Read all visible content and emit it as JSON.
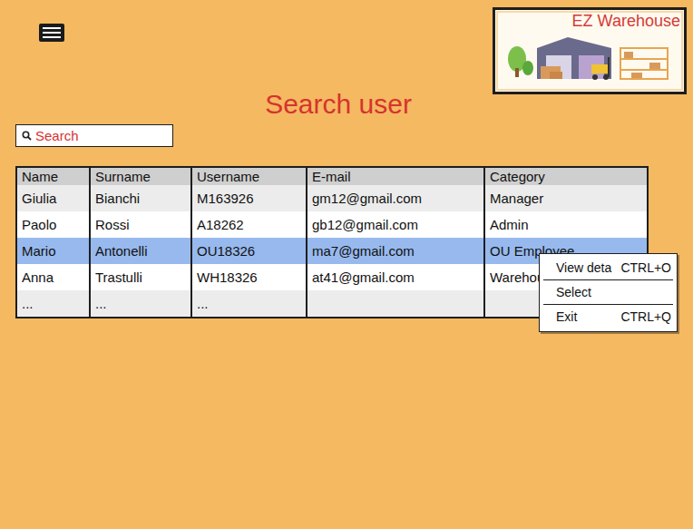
{
  "logo": {
    "text": "EZ Warehouse"
  },
  "title": "Search user",
  "search": {
    "placeholder": "Search"
  },
  "table": {
    "columns": [
      "Name",
      "Surname",
      "Username",
      "E-mail",
      "Category"
    ],
    "rows": [
      {
        "cells": [
          "Giulia",
          "Bianchi",
          "M163926",
          "gm12@gmail.com",
          "Manager"
        ],
        "selected": false
      },
      {
        "cells": [
          "Paolo",
          "Rossi",
          "A18262",
          "gb12@gmail.com",
          "Admin"
        ],
        "selected": false
      },
      {
        "cells": [
          "Mario",
          "Antonelli",
          "OU18326",
          "ma7@gmail.com",
          "OU Employee"
        ],
        "selected": true
      },
      {
        "cells": [
          "Anna",
          "Trastulli",
          "WH18326",
          "at41@gmail.com",
          "Warehouse Em"
        ],
        "selected": false
      },
      {
        "cells": [
          "...",
          "...",
          "...",
          "",
          ""
        ],
        "selected": false
      }
    ]
  },
  "context_menu": {
    "items": [
      {
        "label": "View deta",
        "shortcut": "CTRL+O"
      },
      {
        "label": "Select"
      },
      {
        "label": "Exit",
        "shortcut": "CTRL+Q"
      }
    ]
  }
}
